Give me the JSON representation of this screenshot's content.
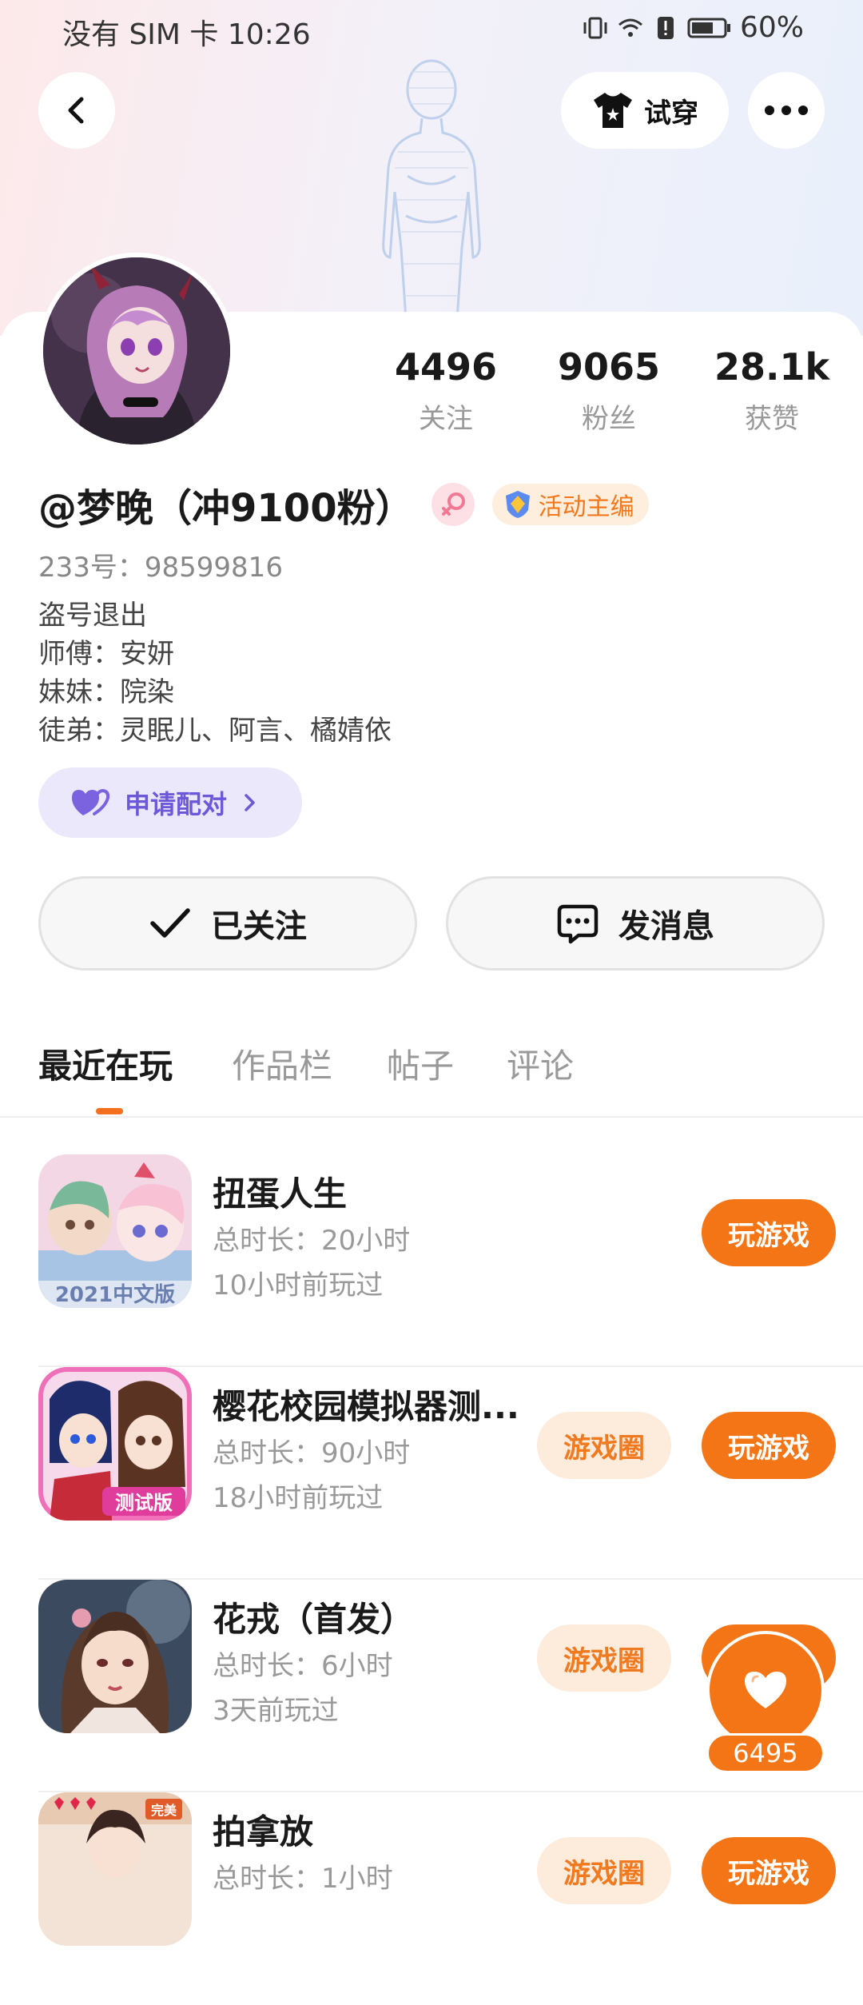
{
  "status_bar": {
    "carrier": "没有 SIM 卡",
    "time": "10:26",
    "battery": "60%"
  },
  "header": {
    "tryon_label": "试穿"
  },
  "profile": {
    "stats": [
      {
        "value": "4496",
        "label": "关注"
      },
      {
        "value": "9065",
        "label": "粉丝"
      },
      {
        "value": "28.1k",
        "label": "获赞"
      }
    ],
    "name": "@梦晚（冲9100粉）",
    "role_badge": "活动主编",
    "uid": "233号：98599816",
    "bio": [
      "盗号退出",
      "师傅：安妍",
      "妹妹：院染",
      "徒弟：灵眠儿、阿言、橘婧依"
    ],
    "pair_label": "申请配对"
  },
  "actions": {
    "following_label": "已关注",
    "message_label": "发消息"
  },
  "tabs": [
    "最近在玩",
    "作品栏",
    "帖子",
    "评论"
  ],
  "games": [
    {
      "title": "扭蛋人生",
      "duration": "总时长：20小时",
      "last_played": "10小时前玩过",
      "has_circle": false,
      "icon_text": "2021中文版"
    },
    {
      "title": "樱花校园模拟器测...",
      "duration": "总时长：90小时",
      "last_played": "18小时前玩过",
      "has_circle": true,
      "icon_text": "测试版"
    },
    {
      "title": "花戎（首发）",
      "duration": "总时长：6小时",
      "last_played": "3天前玩过",
      "has_circle": true,
      "icon_text": ""
    },
    {
      "title": "拍拿放",
      "duration": "总时长：1小时",
      "last_played": "",
      "has_circle": true,
      "icon_text": "完美"
    }
  ],
  "game_buttons": {
    "play_label": "玩游戏",
    "circle_label": "游戏圈"
  },
  "fab": {
    "count": "6495"
  },
  "colors": {
    "accent": "#f47516",
    "pair": "#6d58d8",
    "badge_orange": "#f2781b"
  }
}
